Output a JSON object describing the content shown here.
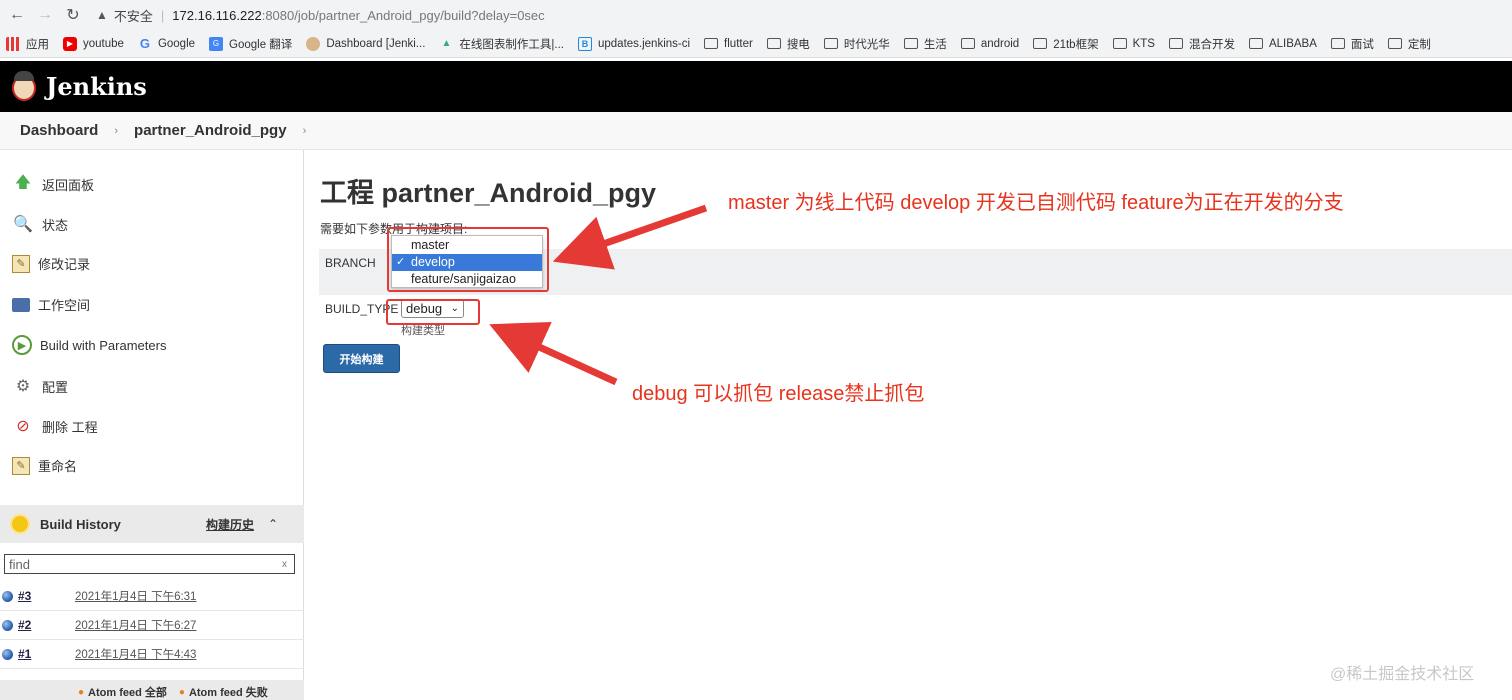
{
  "browser": {
    "back_icon": "arrow-left-icon",
    "forward_icon": "arrow-right-icon",
    "reload_icon": "reload-icon",
    "insecure_label": "不安全",
    "url_host": "172.16.116.222",
    "url_path": ":8080/job/partner_Android_pgy/build?delay=0sec"
  },
  "bookmarks": [
    {
      "label": "应用",
      "icon": "apps-icon"
    },
    {
      "label": "youtube",
      "icon": "youtube-icon"
    },
    {
      "label": "Google",
      "icon": "google-icon"
    },
    {
      "label": "Google 翻译",
      "icon": "google-translate-icon"
    },
    {
      "label": "Dashboard [Jenki...",
      "icon": "jenkins-icon"
    },
    {
      "label": "在线图表制作工具|...",
      "icon": "chart-icon"
    },
    {
      "label": "updates.jenkins-ci",
      "icon": "updates-icon"
    },
    {
      "label": "flutter",
      "icon": "folder-icon"
    },
    {
      "label": "搜电",
      "icon": "folder-icon"
    },
    {
      "label": "时代光华",
      "icon": "folder-icon"
    },
    {
      "label": "生活",
      "icon": "folder-icon"
    },
    {
      "label": "android",
      "icon": "folder-icon"
    },
    {
      "label": "21tb框架",
      "icon": "folder-icon"
    },
    {
      "label": "KTS",
      "icon": "folder-icon"
    },
    {
      "label": "混合开发",
      "icon": "folder-icon"
    },
    {
      "label": "ALIBABA",
      "icon": "folder-icon"
    },
    {
      "label": "面试",
      "icon": "folder-icon"
    },
    {
      "label": "定制",
      "icon": "folder-icon"
    }
  ],
  "header": {
    "title": "Jenkins"
  },
  "breadcrumb": [
    "Dashboard",
    "partner_Android_pgy"
  ],
  "tasks": [
    {
      "label": "返回面板",
      "icon": "up-arrow-icon"
    },
    {
      "label": "状态",
      "icon": "search-icon"
    },
    {
      "label": "修改记录",
      "icon": "notepad-icon"
    },
    {
      "label": "工作空间",
      "icon": "folder-icon"
    },
    {
      "label": "Build with Parameters",
      "icon": "clock-icon"
    },
    {
      "label": "配置",
      "icon": "gear-icon"
    },
    {
      "label": "删除 工程",
      "icon": "no-entry-icon"
    },
    {
      "label": "重命名",
      "icon": "notepad-icon"
    }
  ],
  "build_history": {
    "title": "Build History",
    "trend_link": "构建历史",
    "find_placeholder": "find",
    "clear_label": "x",
    "builds": [
      {
        "number": "#3",
        "date": "2021年1月4日 下午6:31"
      },
      {
        "number": "#2",
        "date": "2021年1月4日 下午6:27"
      },
      {
        "number": "#1",
        "date": "2021年1月4日 下午4:43"
      }
    ],
    "feed_all": "Atom feed 全部",
    "feed_failed": "Atom feed 失败"
  },
  "main": {
    "title": "工程 partner_Android_pgy",
    "description": "需要如下参数用于构建项目:",
    "branch": {
      "label": "BRANCH",
      "options": [
        "master",
        "develop",
        "feature/sanjigaizao"
      ],
      "selected": "develop"
    },
    "build_type": {
      "label": "BUILD_TYPE",
      "value": "debug",
      "helper": "构建类型"
    },
    "start_button": "开始构建"
  },
  "annotations": {
    "branch_note": "master 为线上代码   develop 开发已自测代码  feature为正在开发的分支",
    "build_type_note": "debug 可以抓包  release禁止抓包",
    "color": "#e8331c"
  },
  "watermark": "@稀土掘金技术社区"
}
